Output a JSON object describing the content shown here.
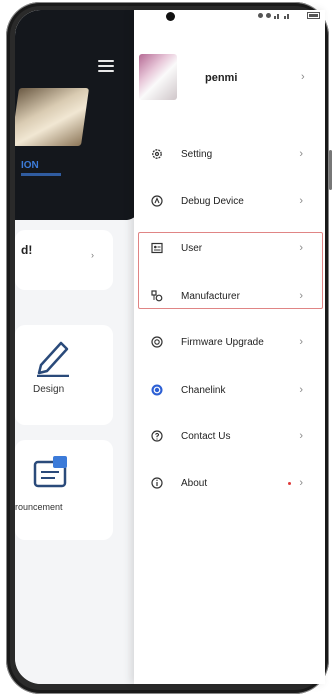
{
  "profile": {
    "name": "penmi"
  },
  "menu": {
    "items": [
      {
        "key": "setting",
        "label": "Setting",
        "icon": "gear-icon"
      },
      {
        "key": "debug-device",
        "label": "Debug Device",
        "icon": "debug-device-icon"
      },
      {
        "key": "user",
        "label": "User",
        "icon": "user-card-icon"
      },
      {
        "key": "manufacturer",
        "label": "Manufacturer",
        "icon": "manufacturer-icon"
      },
      {
        "key": "firmware-upgrade",
        "label": "Firmware Upgrade",
        "icon": "upgrade-icon"
      },
      {
        "key": "chanelink",
        "label": "Chanelink",
        "icon": "chanelink-icon"
      },
      {
        "key": "contact-us",
        "label": "Contact Us",
        "icon": "question-icon"
      },
      {
        "key": "about",
        "label": "About",
        "icon": "info-icon",
        "badge": "red-dot"
      }
    ],
    "chevron": "›"
  },
  "background_app": {
    "header_text": "ION",
    "welcome": "d!",
    "welcome_arrow": "›",
    "design_label": "Design",
    "announcement_label": "rouncement"
  },
  "colors": {
    "highlight": "#e08585",
    "accent_blue": "#3c7bd9",
    "badge_red": "#e03a3a"
  }
}
